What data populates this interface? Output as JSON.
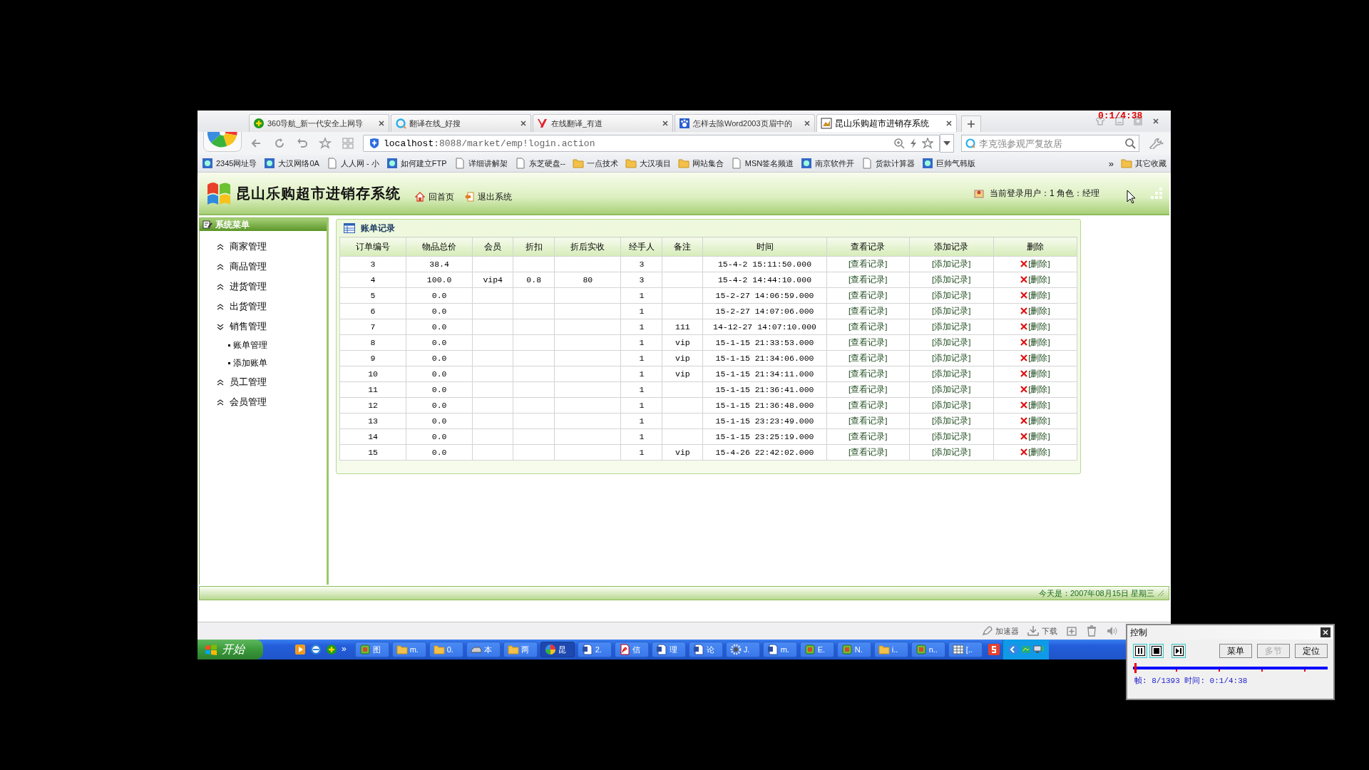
{
  "browser": {
    "tabs": [
      {
        "title": "360导航_新一代安全上网导",
        "kind": "plus",
        "selected": false
      },
      {
        "title": "翻译在线_好搜",
        "kind": "ring",
        "selected": false
      },
      {
        "title": "在线翻译_有道",
        "kind": "red",
        "selected": false
      },
      {
        "title": "怎样去除Word2003页眉中的",
        "kind": "paw",
        "selected": false
      },
      {
        "title": "昆山乐购超市进销存系统",
        "kind": "frame",
        "selected": true
      }
    ],
    "recording_timer": "0:1/4:38",
    "address": {
      "host": "localhost",
      "path": ":8088/market/emp!login.action"
    },
    "search": {
      "placeholder": "李克强参观严复故居"
    },
    "bookmarks": [
      {
        "label": "2345网址导",
        "kind": "site"
      },
      {
        "label": "大汉网络0A",
        "kind": "site"
      },
      {
        "label": "人人网 - 小",
        "kind": "page"
      },
      {
        "label": "如何建立FTP",
        "kind": "site"
      },
      {
        "label": "详细讲解架",
        "kind": "page"
      },
      {
        "label": "东芝硬盘--",
        "kind": "page"
      },
      {
        "label": "一点技术",
        "kind": "folder"
      },
      {
        "label": "大汉项目",
        "kind": "folder"
      },
      {
        "label": "网站集合",
        "kind": "folder"
      },
      {
        "label": "MSN签名频道",
        "kind": "page"
      },
      {
        "label": "南京软件开",
        "kind": "site"
      },
      {
        "label": "货款计算器",
        "kind": "page"
      },
      {
        "label": "巨帅气韩版",
        "kind": "site"
      }
    ],
    "bookmarks_more": "»",
    "other_bookmarks": "其它收藏"
  },
  "app": {
    "title": "昆山乐购超市进销存系统",
    "nav": [
      "回首页",
      "退出系统"
    ],
    "user_info": "当前登录用户：1  角色：经理"
  },
  "sidebar": {
    "title": "系统菜单",
    "items": [
      {
        "label": "商家管理",
        "expanded": false
      },
      {
        "label": "商品管理",
        "expanded": false
      },
      {
        "label": "进货管理",
        "expanded": false
      },
      {
        "label": "出货管理",
        "expanded": false
      },
      {
        "label": "销售管理",
        "expanded": true,
        "children": [
          {
            "label": "账单管理"
          },
          {
            "label": "添加账单"
          }
        ]
      },
      {
        "label": "员工管理",
        "expanded": false
      },
      {
        "label": "会员管理",
        "expanded": false
      }
    ]
  },
  "panel": {
    "title": "账单记录"
  },
  "table": {
    "columns": [
      {
        "label": "订单编号",
        "kind": "text"
      },
      {
        "label": "物品总价",
        "kind": "text"
      },
      {
        "label": "会员",
        "kind": "text"
      },
      {
        "label": "折扣",
        "kind": "text"
      },
      {
        "label": "折后实收",
        "kind": "text"
      },
      {
        "label": "经手人",
        "kind": "text"
      },
      {
        "label": "备注",
        "kind": "text"
      },
      {
        "label": "时间",
        "kind": "text"
      },
      {
        "label": "查看记录",
        "kind": "link"
      },
      {
        "label": "添加记录",
        "kind": "link"
      },
      {
        "label": "删除",
        "kind": "delete"
      }
    ],
    "rows": [
      {
        "cells": [
          "3",
          "38.4",
          null,
          null,
          null,
          "3",
          null,
          "15-4-2 15:11:50.000",
          "[查看记录]",
          "[添加记录]",
          "[删除]"
        ]
      },
      {
        "cells": [
          "4",
          "100.0",
          "vip4",
          "0.8",
          "80",
          "3",
          null,
          "15-4-2 14:44:10.000",
          "[查看记录]",
          "[添加记录]",
          "[删除]"
        ]
      },
      {
        "cells": [
          "5",
          "0.0",
          null,
          null,
          null,
          "1",
          null,
          "15-2-27 14:06:59.000",
          "[查看记录]",
          "[添加记录]",
          "[删除]"
        ]
      },
      {
        "cells": [
          "6",
          "0.0",
          null,
          null,
          null,
          "1",
          null,
          "15-2-27 14:07:06.000",
          "[查看记录]",
          "[添加记录]",
          "[删除]"
        ]
      },
      {
        "cells": [
          "7",
          "0.0",
          null,
          null,
          null,
          "1",
          "111",
          "14-12-27 14:07:10.000",
          "[查看记录]",
          "[添加记录]",
          "[删除]"
        ]
      },
      {
        "cells": [
          "8",
          "0.0",
          null,
          null,
          null,
          "1",
          "vip",
          "15-1-15 21:33:53.000",
          "[查看记录]",
          "[添加记录]",
          "[删除]"
        ]
      },
      {
        "cells": [
          "9",
          "0.0",
          null,
          null,
          null,
          "1",
          "vip",
          "15-1-15 21:34:06.000",
          "[查看记录]",
          "[添加记录]",
          "[删除]"
        ]
      },
      {
        "cells": [
          "10",
          "0.0",
          null,
          null,
          null,
          "1",
          "vip",
          "15-1-15 21:34:11.000",
          "[查看记录]",
          "[添加记录]",
          "[删除]"
        ]
      },
      {
        "cells": [
          "11",
          "0.0",
          null,
          null,
          null,
          "1",
          null,
          "15-1-15 21:36:41.000",
          "[查看记录]",
          "[添加记录]",
          "[删除]"
        ]
      },
      {
        "cells": [
          "12",
          "0.0",
          null,
          null,
          null,
          "1",
          null,
          "15-1-15 21:36:48.000",
          "[查看记录]",
          "[添加记录]",
          "[删除]"
        ]
      },
      {
        "cells": [
          "13",
          "0.0",
          null,
          null,
          null,
          "1",
          null,
          "15-1-15 23:23:49.000",
          "[查看记录]",
          "[添加记录]",
          "[删除]"
        ]
      },
      {
        "cells": [
          "14",
          "0.0",
          null,
          null,
          null,
          "1",
          null,
          "15-1-15 23:25:19.000",
          "[查看记录]",
          "[添加记录]",
          "[删除]"
        ]
      },
      {
        "cells": [
          "15",
          "0.0",
          null,
          null,
          null,
          "1",
          "vip",
          "15-4-26 22:42:02.000",
          "[查看记录]",
          "[添加记录]",
          "[删除]"
        ]
      }
    ]
  },
  "footer": "今天是：2007年08月15日 星期三",
  "status_bar": {
    "items": [
      "加速器",
      "下载"
    ]
  },
  "taskbar": {
    "start": "开始",
    "quick_launch_more": "»",
    "tasks": [
      {
        "label": "图",
        "kind": "app",
        "selected": false
      },
      {
        "label": "m.",
        "kind": "folder",
        "selected": false
      },
      {
        "label": "0.",
        "kind": "folder",
        "selected": false
      },
      {
        "label": "本",
        "kind": "drive",
        "selected": false
      },
      {
        "label": "两",
        "kind": "folder",
        "selected": false
      },
      {
        "label": "昆",
        "kind": "browser",
        "selected": true
      },
      {
        "label": "2.",
        "kind": "doc",
        "selected": false
      },
      {
        "label": "信",
        "kind": "pdf",
        "selected": false
      },
      {
        "label": "理",
        "kind": "doc",
        "selected": false
      },
      {
        "label": "论",
        "kind": "doc",
        "selected": false
      },
      {
        "label": "J.",
        "kind": "gear",
        "selected": false
      },
      {
        "label": "m.",
        "kind": "doc",
        "selected": false
      },
      {
        "label": "E.",
        "kind": "app",
        "selected": false
      },
      {
        "label": "N.",
        "kind": "app",
        "selected": false
      },
      {
        "label": "i..",
        "kind": "folder",
        "selected": false
      },
      {
        "label": "n..",
        "kind": "app",
        "selected": false
      },
      {
        "label": "[..",
        "kind": "table",
        "selected": false
      }
    ]
  },
  "recorder": {
    "title": "控制",
    "buttons": [
      {
        "label": "菜单",
        "disabled": false
      },
      {
        "label": "多节",
        "disabled": true
      },
      {
        "label": "定位",
        "disabled": false
      }
    ],
    "level": 0.006,
    "status": "帧: 8/1393 时间: 0:1/4:38"
  }
}
